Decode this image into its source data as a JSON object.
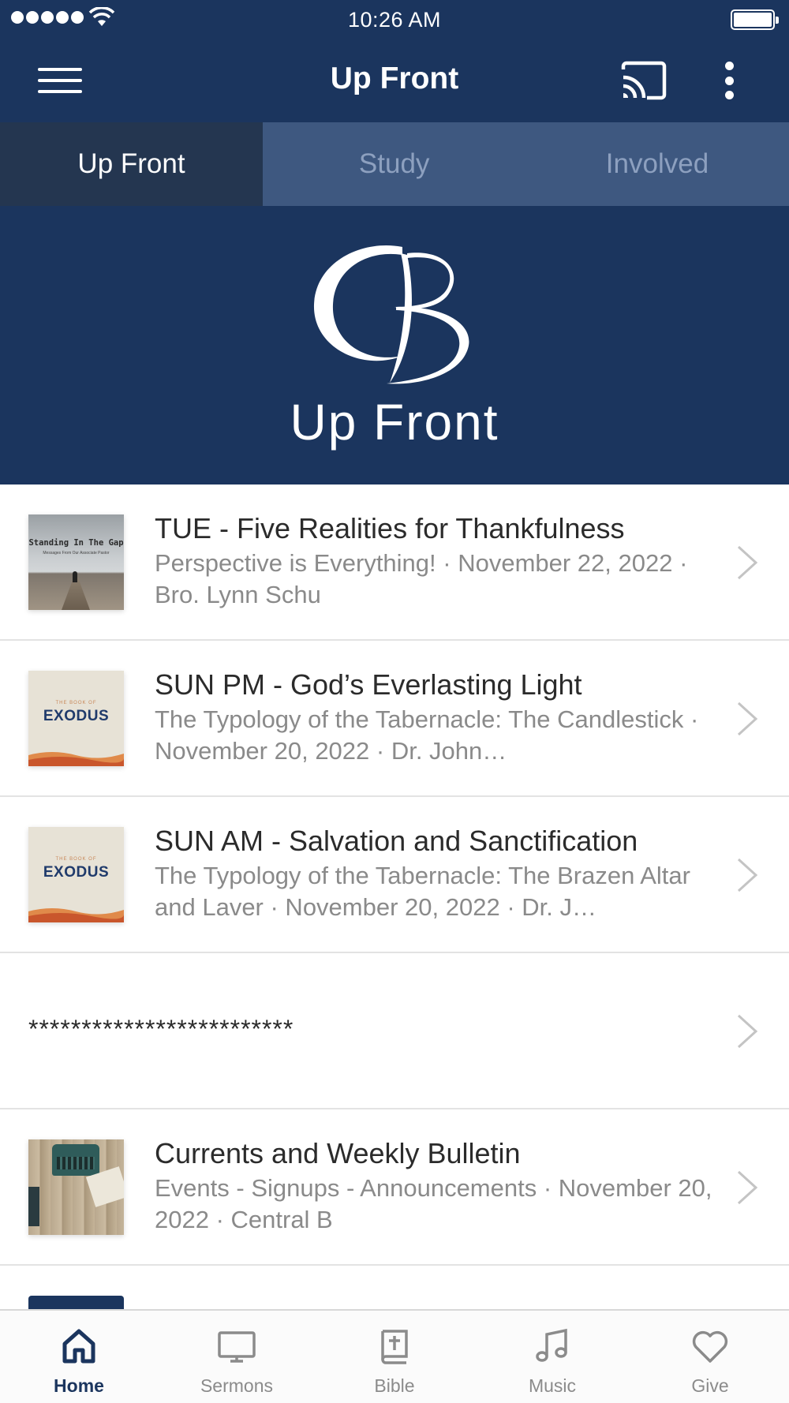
{
  "status_bar": {
    "time": "10:26 AM"
  },
  "app_bar": {
    "title": "Up Front"
  },
  "tabs": [
    {
      "label": "Up Front",
      "active": true
    },
    {
      "label": "Study",
      "active": false
    },
    {
      "label": "Involved",
      "active": false
    }
  ],
  "banner": {
    "brand": "Up Front"
  },
  "list": [
    {
      "title": "TUE - Five Realities for Thankfulness",
      "meta": "Perspective is Everything! · November 22, 2022 · Bro. Lynn Schu",
      "thumb": "Standing In The Gap",
      "thumb_sub": "Messages From Our Associate Pastor"
    },
    {
      "title": "SUN PM - God’s Everlasting Light",
      "meta": "The Typology of the Tabernacle: The Candlestick · November 20, 2022 · Dr. John…",
      "thumb": "EXODUS",
      "thumb_sub": "THE BOOK OF"
    },
    {
      "title": "SUN AM - Salvation and Sanctification",
      "meta": "The Typology of the Tabernacle: The Brazen Altar and Laver · November 20, 2022 · Dr. J…",
      "thumb": "EXODUS",
      "thumb_sub": "THE BOOK OF"
    },
    {
      "title": "*************************"
    },
    {
      "title": "Currents and Weekly Bulletin",
      "meta": "Events - Signups - Announcements · November 20, 2022 · Central B"
    }
  ],
  "bottom_nav": [
    {
      "label": "Home",
      "icon": "home-icon",
      "active": true
    },
    {
      "label": "Sermons",
      "icon": "monitor-icon",
      "active": false
    },
    {
      "label": "Bible",
      "icon": "bible-icon",
      "active": false
    },
    {
      "label": "Music",
      "icon": "music-note-icon",
      "active": false
    },
    {
      "label": "Give",
      "icon": "heart-icon",
      "active": false
    }
  ],
  "colors": {
    "primary": "#1b355e",
    "tab_bar": "#3e5880",
    "tab_active": "#243650",
    "nav_inactive": "#8b8b8b"
  }
}
